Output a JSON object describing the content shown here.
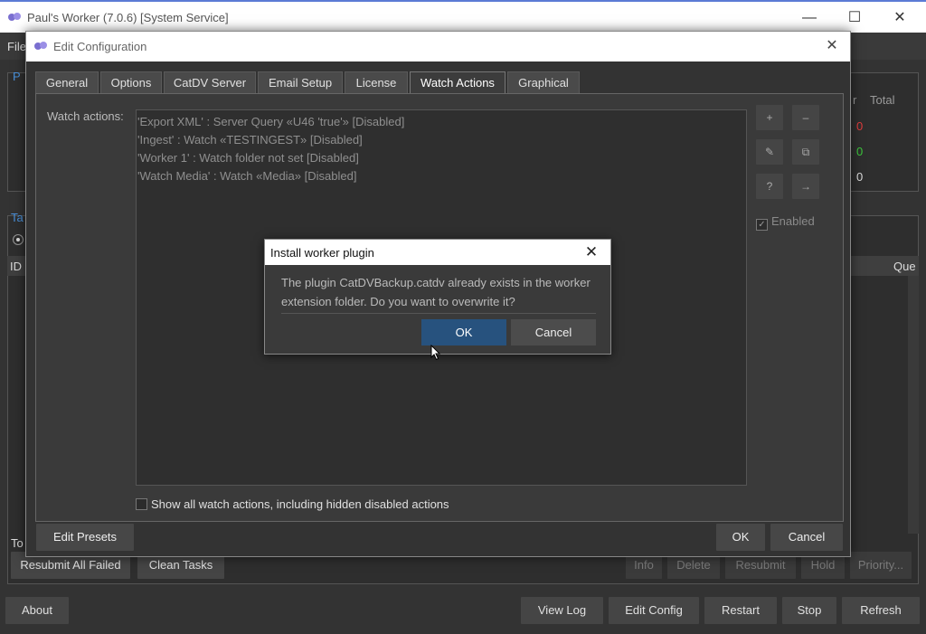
{
  "main_window": {
    "title": "Paul's Worker (7.0.6) [System Service]",
    "menu_file": "File",
    "bg_labels": {
      "p": "P",
      "ta": "Ta",
      "id": "ID",
      "r": "r",
      "total": "Total",
      "count_red": "0",
      "count_green": "0",
      "count_plain": "0",
      "que": "Que",
      "to": "To"
    },
    "task_buttons": {
      "resubmit_all_failed": "Resubmit All Failed",
      "clean_tasks": "Clean Tasks",
      "info": "Info",
      "delete": "Delete",
      "resubmit": "Resubmit",
      "hold": "Hold",
      "priority": "Priority..."
    },
    "bottom_buttons": {
      "about": "About",
      "view_log": "View Log",
      "edit_config": "Edit Config",
      "restart": "Restart",
      "stop": "Stop",
      "refresh": "Refresh"
    },
    "colors": {
      "red": "#e03c3c",
      "green": "#3cc83c",
      "accent": "#5b7bd5"
    }
  },
  "config_dialog": {
    "title": "Edit Configuration",
    "tabs": [
      {
        "label": "General"
      },
      {
        "label": "Options"
      },
      {
        "label": "CatDV Server"
      },
      {
        "label": "Email Setup"
      },
      {
        "label": "License"
      },
      {
        "label": "Watch Actions"
      },
      {
        "label": "Graphical"
      }
    ],
    "active_tab": "Watch Actions",
    "watch_actions_label": "Watch actions:",
    "watch_actions": [
      "'Export XML' : Server Query «U46 'true'» [Disabled]",
      "'Ingest' : Watch «TESTINGEST» [Disabled]",
      "'Worker 1' : Watch folder not set [Disabled]",
      "'Watch Media' : Watch «Media» [Disabled]"
    ],
    "tool_buttons": {
      "add": "+",
      "remove": "–",
      "edit": "✎",
      "duplicate": "⧉",
      "help": "?",
      "move": "→"
    },
    "enabled_label": "Enabled",
    "show_all_label": "Show all watch actions, including hidden disabled actions",
    "edit_presets": "Edit Presets",
    "ok": "OK",
    "cancel": "Cancel"
  },
  "install_dialog": {
    "title": "Install worker plugin",
    "message": "The plugin CatDVBackup.catdv already exists in the worker extension folder. Do you want to overwrite it?",
    "ok": "OK",
    "cancel": "Cancel",
    "ok_color": "#27527e"
  }
}
